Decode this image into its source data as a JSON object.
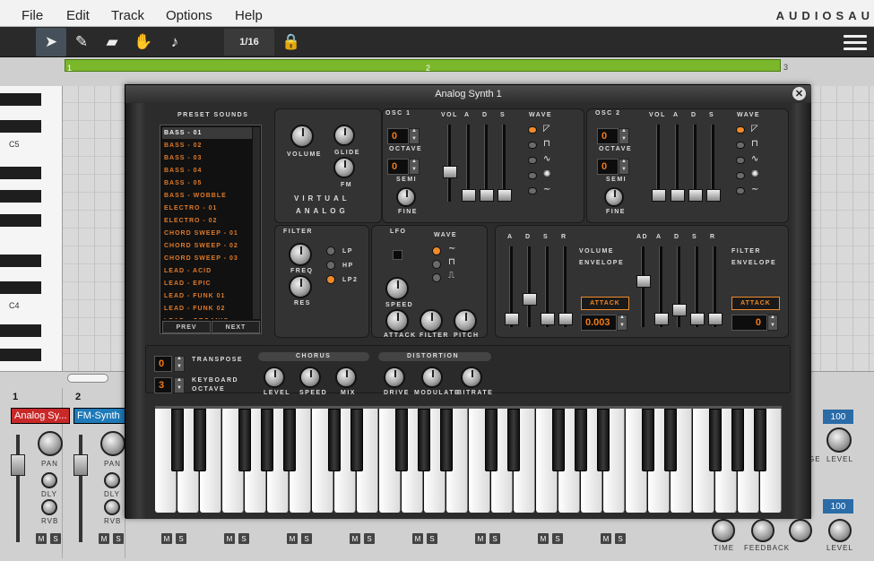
{
  "menu": {
    "items": [
      "File",
      "Edit",
      "Track",
      "Options",
      "Help"
    ],
    "brand": "AUDIOSAU"
  },
  "toolbar": {
    "grid": "1/16"
  },
  "timeline": {
    "bars": [
      "1",
      "2",
      "3"
    ]
  },
  "roll": {
    "labels": [
      "C5",
      "C4"
    ]
  },
  "mixer": {
    "channels": [
      {
        "num": "1",
        "instrument": "Analog Sy...",
        "color": "#d42a2a"
      },
      {
        "num": "2",
        "instrument": "FM-Synth",
        "color": "#1e7ab8"
      }
    ],
    "pan_label": "PAN",
    "dly_label": "DLY",
    "rvb_label": "RVB",
    "m": "M",
    "s": "S",
    "right": {
      "val1": "100",
      "val2": "100",
      "level": "LEVEL",
      "time": "TIME",
      "feedback": "FEEDBACK",
      "ge": "GE",
      "level2": "LEVEL"
    }
  },
  "synth": {
    "title": "Analog Synth 1",
    "presets_title": "PRESET SOUNDS",
    "presets": [
      "BASS - 01",
      "BASS - 02",
      "BASS - 03",
      "BASS - 04",
      "BASS - 05",
      "BASS - WOBBLE",
      "ELECTRO - 01",
      "ELECTRO - 02",
      "CHORD SWEEP - 01",
      "CHORD SWEEP - 02",
      "CHORD SWEEP - 03",
      "LEAD - ACID",
      "LEAD - EPIC",
      "LEAD - FUNK 01",
      "LEAD - FUNK 02",
      "LEAD - ORGANIC"
    ],
    "prev": "PREV",
    "next": "NEXT",
    "volume": "VOLUME",
    "glide": "GLIDE",
    "fm": "FM",
    "brand1": "VIRTUAL",
    "brand2": "ANALOG",
    "osc1": {
      "title": "OSC 1",
      "octave": "0",
      "octave_lbl": "OCTAVE",
      "semi": "0",
      "semi_lbl": "SEMI",
      "fine_lbl": "FINE"
    },
    "osc2": {
      "title": "OSC 2",
      "octave": "0",
      "octave_lbl": "OCTAVE",
      "semi": "0",
      "semi_lbl": "SEMI",
      "fine_lbl": "FINE"
    },
    "vol": "VOL",
    "a": "A",
    "d": "D",
    "s": "S",
    "r": "R",
    "ad": "AD",
    "wave": "WAVE",
    "filter": {
      "title": "FILTER",
      "freq": "FREQ",
      "res": "RES",
      "lp": "LP",
      "hp": "HP",
      "lp2": "LP2"
    },
    "lfo": {
      "title": "LFO",
      "wave": "WAVE",
      "speed": "SPEED",
      "attack": "ATTACK",
      "filter": "FILTER",
      "pitch": "PITCH"
    },
    "venv": {
      "l1": "VOLUME",
      "l2": "ENVELOPE",
      "attack": "ATTACK",
      "value": "0.003"
    },
    "fenv": {
      "l1": "FILTER",
      "l2": "ENVELOPE",
      "attack": "ATTACK",
      "value": "0"
    },
    "transpose": {
      "value": "0",
      "label": "TRANSPOSE"
    },
    "kb_octave": {
      "value": "3",
      "l1": "KEYBOARD",
      "l2": "OCTAVE"
    },
    "chorus": {
      "title": "CHORUS",
      "level": "LEVEL",
      "speed": "SPEED",
      "mix": "MIX"
    },
    "distortion": {
      "title": "DISTORTION",
      "drive": "DRIVE",
      "modulate": "MODULATE",
      "bitrate": "BITRATE"
    }
  }
}
